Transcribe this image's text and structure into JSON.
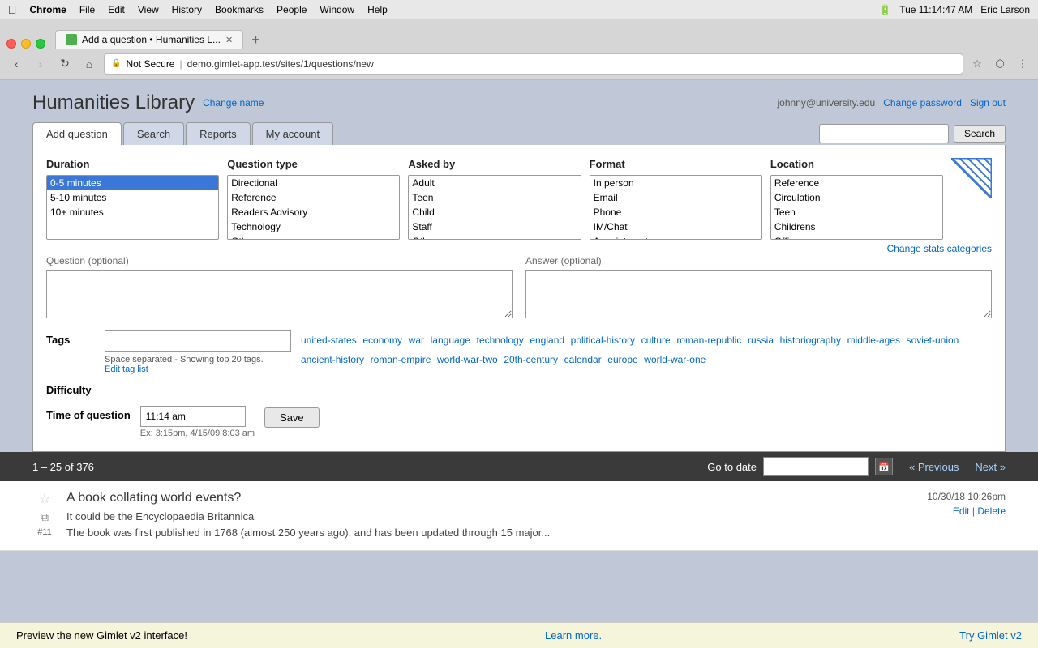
{
  "os": {
    "time": "Tue 11:14:47 AM",
    "user": "Eric Larson",
    "battery": "100%",
    "menus": [
      "Chrome",
      "File",
      "Edit",
      "View",
      "History",
      "Bookmarks",
      "People",
      "Window",
      "Help"
    ]
  },
  "browser": {
    "tab_title": "Add a question • Humanities L...",
    "tab_close": "✕",
    "url": "demo.gimlet-app.test/sites/1/questions/new",
    "url_prefix": "Not Secure",
    "back_disabled": false,
    "forward_disabled": true
  },
  "app": {
    "library_name": "Humanities Library",
    "change_name_label": "Change name",
    "user_email": "johnny@university.edu",
    "change_password_label": "Change password",
    "sign_out_label": "Sign out"
  },
  "nav": {
    "tabs": [
      {
        "label": "Add question",
        "active": true
      },
      {
        "label": "Search",
        "active": false
      },
      {
        "label": "Reports",
        "active": false
      },
      {
        "label": "My account",
        "active": false
      }
    ],
    "search_placeholder": "",
    "search_label": "Search"
  },
  "form": {
    "duration_label": "Duration",
    "duration_options": [
      {
        "value": "0-5 minutes",
        "selected": true
      },
      {
        "value": "5-10 minutes",
        "selected": false
      },
      {
        "value": "10+ minutes",
        "selected": false
      }
    ],
    "question_type_label": "Question type",
    "question_type_options": [
      {
        "value": "Directional",
        "selected": false
      },
      {
        "value": "Reference",
        "selected": false
      },
      {
        "value": "Readers Advisory",
        "selected": false
      },
      {
        "value": "Technology",
        "selected": false
      },
      {
        "value": "Other",
        "selected": false
      }
    ],
    "asked_by_label": "Asked by",
    "asked_by_options": [
      {
        "value": "Adult",
        "selected": false
      },
      {
        "value": "Teen",
        "selected": false
      },
      {
        "value": "Child",
        "selected": false
      },
      {
        "value": "Staff",
        "selected": false
      },
      {
        "value": "Other",
        "selected": false
      }
    ],
    "format_label": "Format",
    "format_options": [
      {
        "value": "In person",
        "selected": false
      },
      {
        "value": "Email",
        "selected": false
      },
      {
        "value": "Phone",
        "selected": false
      },
      {
        "value": "IM/Chat",
        "selected": false
      },
      {
        "value": "Appointment",
        "selected": false
      }
    ],
    "location_label": "Location",
    "location_options": [
      {
        "value": "Reference",
        "selected": false
      },
      {
        "value": "Circulation",
        "selected": false
      },
      {
        "value": "Teen",
        "selected": false
      },
      {
        "value": "Childrens",
        "selected": false
      },
      {
        "value": "Office",
        "selected": false
      }
    ],
    "question_label": "Question",
    "question_optional": "(optional)",
    "answer_label": "Answer",
    "answer_optional": "(optional)",
    "tags_label": "Tags",
    "tags_hint": "Space separated - Showing top 20 tags.",
    "edit_tag_list": "Edit tag list",
    "tags": [
      "united-states",
      "economy",
      "war",
      "language",
      "technology",
      "england",
      "political-history",
      "culture",
      "roman-republic",
      "russia",
      "historiography",
      "middle-ages",
      "soviet-union",
      "ancient-history",
      "roman-empire",
      "world-war-two",
      "20th-century",
      "calendar",
      "europe",
      "world-war-one"
    ],
    "difficulty_label": "Difficulty",
    "time_of_question_label": "Time of question",
    "time_value": "11:14 am",
    "time_example": "Ex: 3:15pm, 4/15/09 8:03 am",
    "save_label": "Save",
    "change_stats_label": "Change stats categories"
  },
  "questions_list": {
    "count_text": "1 – 25 of 376",
    "goto_label": "Go to date",
    "prev_label": "« Previous",
    "next_label": "Next »",
    "items": [
      {
        "num": "#11",
        "title": "A book collating world events?",
        "date": "10/30/18 10:26pm",
        "edit_label": "Edit",
        "delete_label": "Delete",
        "text": "It could be the Encyclopaedia Britannica",
        "text2": "The book was first published in 1768 (almost 250 years ago), and has been updated through 15 major..."
      }
    ]
  },
  "preview": {
    "text": "Preview the new Gimlet v2 interface!",
    "learn_more": "Learn more.",
    "try_label": "Try Gimlet v2"
  }
}
